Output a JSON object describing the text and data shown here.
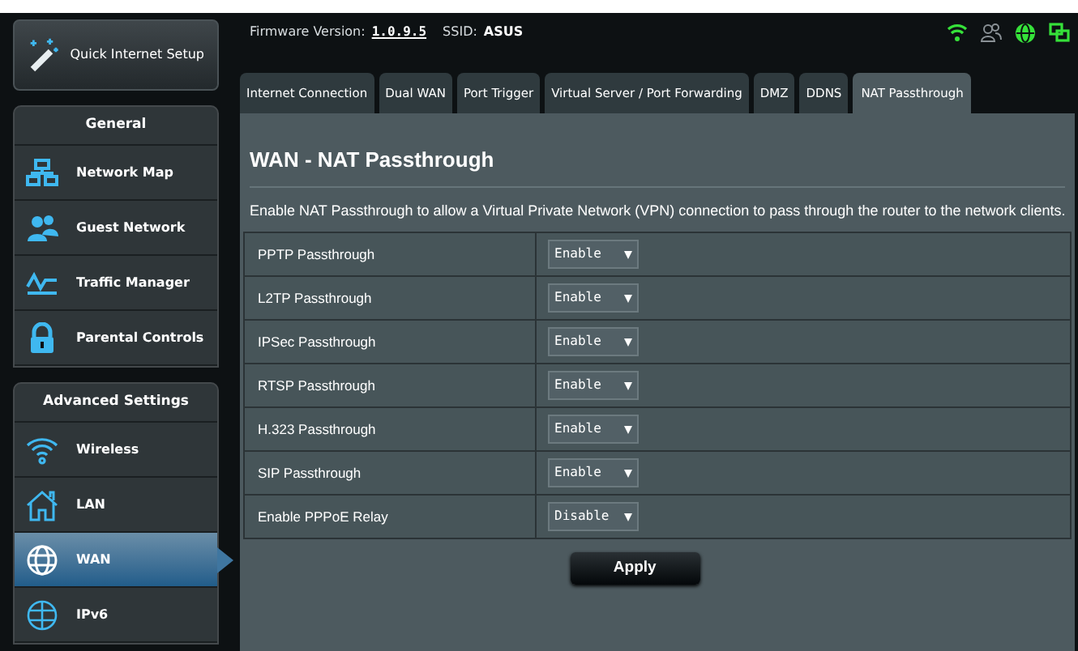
{
  "quick_setup": {
    "label": "Quick Internet Setup"
  },
  "sidebar": [
    {
      "heading": "General",
      "items": [
        {
          "label": "Network Map",
          "kind": "network",
          "selected": false
        },
        {
          "label": "Guest Network",
          "kind": "guests",
          "selected": false
        },
        {
          "label": "Traffic Manager",
          "kind": "traffic",
          "selected": false
        },
        {
          "label": "Parental Controls",
          "kind": "lock",
          "selected": false
        }
      ]
    },
    {
      "heading": "Advanced Settings",
      "items": [
        {
          "label": "Wireless",
          "kind": "wifi",
          "selected": false
        },
        {
          "label": "LAN",
          "kind": "home",
          "selected": false
        },
        {
          "label": "WAN",
          "kind": "globe",
          "selected": true
        },
        {
          "label": "IPv6",
          "kind": "ipv6",
          "selected": false
        }
      ]
    }
  ],
  "header": {
    "firmware_label": "Firmware Version:",
    "firmware_version": "1.0.9.5",
    "ssid_label": "SSID:",
    "ssid": "ASUS"
  },
  "status_icons": [
    {
      "kind": "wifi",
      "active": true
    },
    {
      "kind": "clients",
      "active": false
    },
    {
      "kind": "internet",
      "active": true
    },
    {
      "kind": "usb",
      "active": true
    }
  ],
  "tabs": [
    {
      "label": "Internet Connection",
      "selected": false
    },
    {
      "label": "Dual WAN",
      "selected": false
    },
    {
      "label": "Port Trigger",
      "selected": false
    },
    {
      "label": "Virtual Server / Port Forwarding",
      "selected": false
    },
    {
      "label": "DMZ",
      "selected": false
    },
    {
      "label": "DDNS",
      "selected": false
    },
    {
      "label": "NAT Passthrough",
      "selected": true
    }
  ],
  "page_title": "WAN - NAT Passthrough",
  "description": "Enable NAT Passthrough to allow a Virtual Private Network (VPN) connection to pass through the router to the network clients.",
  "settings": [
    {
      "label": "PPTP Passthrough",
      "value": "Enable"
    },
    {
      "label": "L2TP Passthrough",
      "value": "Enable"
    },
    {
      "label": "IPSec Passthrough",
      "value": "Enable"
    },
    {
      "label": "RTSP Passthrough",
      "value": "Enable"
    },
    {
      "label": "H.323 Passthrough",
      "value": "Enable"
    },
    {
      "label": "SIP Passthrough",
      "value": "Enable"
    },
    {
      "label": "Enable PPPoE Relay",
      "value": "Disable"
    }
  ],
  "apply_button": "Apply"
}
